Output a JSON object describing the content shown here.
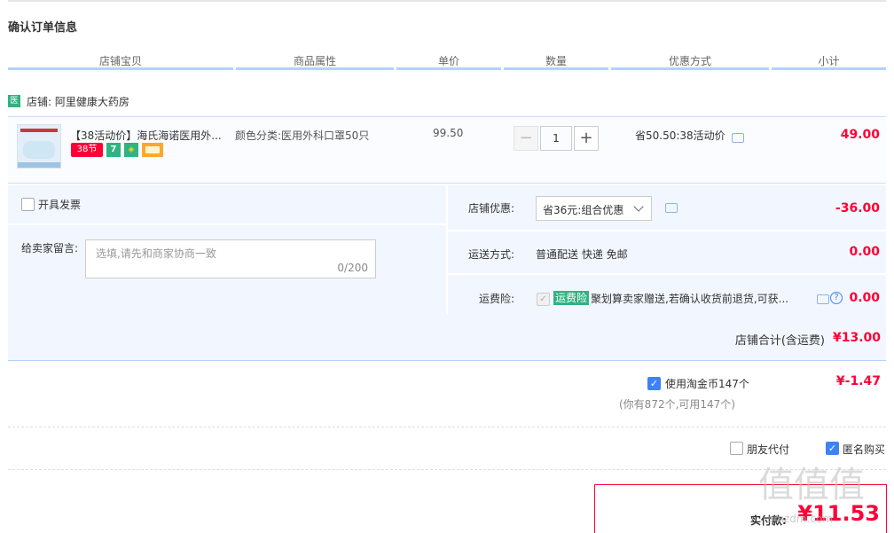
{
  "page": {
    "title": "确认订单信息"
  },
  "columns": [
    "店铺宝贝",
    "商品属性",
    "单价",
    "数量",
    "优惠方式",
    "小计"
  ],
  "shop": {
    "icon_label": "医",
    "label": "店铺:",
    "name": "阿里健康大药房"
  },
  "item": {
    "title": "【38活动价】海氏海诺医用外...",
    "badge_38": "38节",
    "badge_7": "7",
    "attribute": "颜色分类:医用外科口罩50只",
    "unit_price": "99.50",
    "quantity": "1",
    "qty_minus": "−",
    "qty_plus": "+",
    "discount": "省50.50:38活动价",
    "subtotal": "49.00"
  },
  "invoice": {
    "label": "开具发票",
    "checked": false
  },
  "message": {
    "label": "给卖家留言:",
    "placeholder": "选填,请先和商家协商一致",
    "counter": "0/200"
  },
  "shop_discount": {
    "label": "店铺优惠:",
    "selected": "省36元:组合优惠",
    "amount": "-36.00"
  },
  "shipping": {
    "label": "运送方式:",
    "value": "普通配送 快递 免邮",
    "amount": "0.00"
  },
  "insurance": {
    "label": "运费险:",
    "tag": "运费险",
    "text": "聚划算卖家赠送,若确认收货前退货,可获...",
    "help": "?",
    "amount": "0.00"
  },
  "shop_total": {
    "label": "店铺合计(含运费)",
    "amount": "¥13.00"
  },
  "coins": {
    "label": "使用淘金币147个",
    "amount": "¥-1.47",
    "note": "(你有872个,可用147个)",
    "checked": true
  },
  "options": {
    "friend_pay": "朋友代付",
    "friend_checked": false,
    "anonymous": "匿名购买",
    "anonymous_checked": true
  },
  "payment": {
    "label": "实付款:",
    "amount": "¥11.53"
  },
  "watermark": {
    "text": "值值值",
    "sub": "smzdm.com"
  },
  "colors": {
    "price_red": "#ff0036",
    "accent_blue": "#3d83f6",
    "panel_bg": "#f2f7ff",
    "header_line": "#b2d1ff"
  }
}
